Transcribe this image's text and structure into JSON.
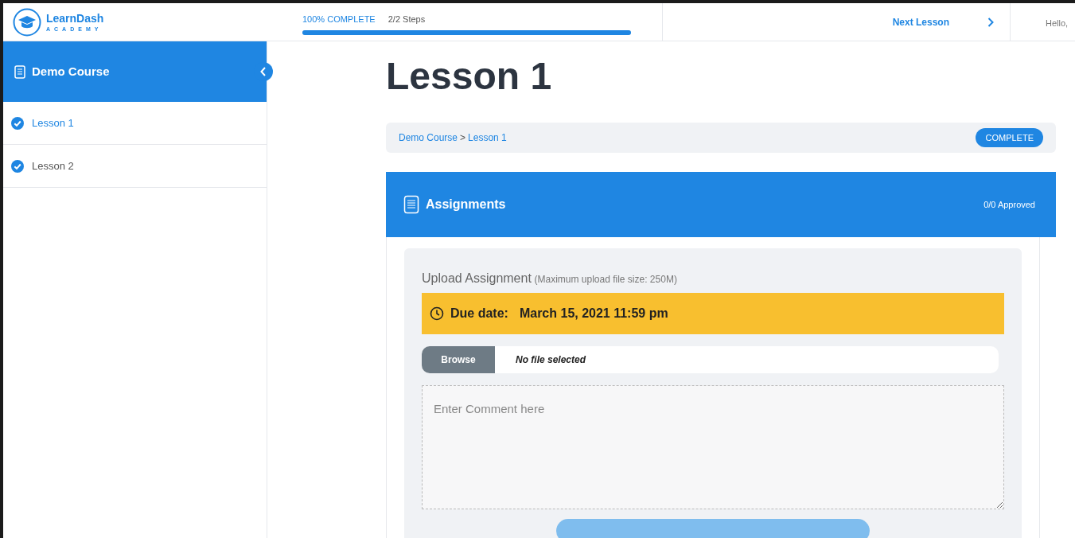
{
  "header": {
    "logo": {
      "name": "LearnDash",
      "tagline": "ACADEMY"
    },
    "progress": {
      "label": "100% COMPLETE",
      "steps": "2/2 Steps",
      "level": 1.0
    },
    "next_lesson": "Next Lesson",
    "greeting": "Hello,"
  },
  "sidebar": {
    "course_title": "Demo Course",
    "lessons": [
      {
        "label": "Lesson 1",
        "complete": true,
        "selected": true
      },
      {
        "label": "Lesson 2",
        "complete": true,
        "selected": false
      }
    ]
  },
  "main": {
    "title": "Lesson 1",
    "breadcrumb": [
      "Demo Course",
      "Lesson 1"
    ],
    "breadcrumb_separator": ">",
    "status": "COMPLETE",
    "assignments": {
      "title": "Assignments",
      "approved": "0/0 Approved",
      "upload": {
        "title": "Upload Assignment",
        "note": "(Maximum upload file size: 250M)",
        "due_label": "Due date:",
        "due_value": "March 15, 2021 11:59 pm",
        "browse": "Browse",
        "file_status": "No file selected",
        "comment_placeholder": "Enter Comment here"
      }
    }
  }
}
